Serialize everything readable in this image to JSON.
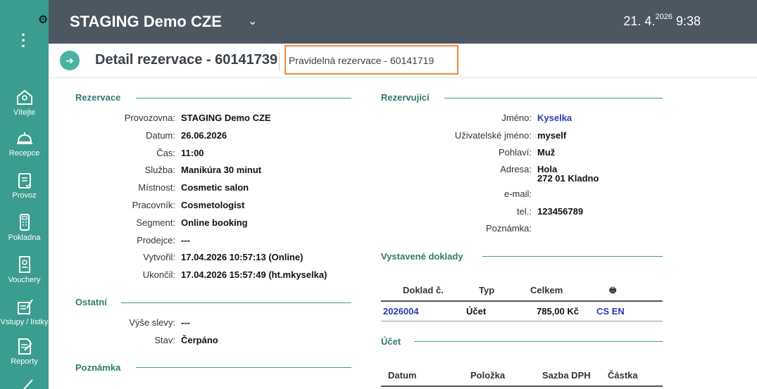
{
  "app": {
    "title": "STAGING Demo CZE",
    "date": "21. 4.",
    "year": "2026",
    "time": "9:38"
  },
  "sidebar": {
    "items": [
      {
        "label": "Vítejte",
        "icon": "home-icon"
      },
      {
        "label": "Recepce",
        "icon": "bell-icon"
      },
      {
        "label": "Provoz",
        "icon": "clipboard-icon"
      },
      {
        "label": "Pokladna",
        "icon": "cash-register-icon"
      },
      {
        "label": "Vouchery",
        "icon": "voucher-icon"
      },
      {
        "label": "Vstupy / lístky",
        "icon": "ticket-icon"
      },
      {
        "label": "Reporty",
        "icon": "report-icon"
      }
    ]
  },
  "detail": {
    "title": "Detail rezervace - 60141739",
    "regular": "Pravidelná rezervace - 60141719"
  },
  "reservation": {
    "section": "Rezervace",
    "rows": [
      {
        "key": "Provozovna:",
        "value": "STAGING Demo CZE"
      },
      {
        "key": "Datum:",
        "value": "26.06.2026"
      },
      {
        "key": "Čas:",
        "value": "11:00"
      },
      {
        "key": "Služba:",
        "value": "Manikúra 30 minut"
      },
      {
        "key": "Místnost:",
        "value": "Cosmetic salon"
      },
      {
        "key": "Pracovník:",
        "value": "Cosmetologist"
      },
      {
        "key": "Segment:",
        "value": "Online booking"
      },
      {
        "key": "Prodejce:",
        "value": "---"
      },
      {
        "key": "Vytvořil:",
        "value": "17.04.2026 10:57:13 (Online)"
      },
      {
        "key": "Ukončil:",
        "value": "17.04.2026 15:57:49 (ht.mkyselka)"
      }
    ]
  },
  "other": {
    "section": "Ostatní",
    "rows": [
      {
        "key": "Výše slevy:",
        "value": "---"
      },
      {
        "key": "Stav:",
        "value": "Čerpáno"
      }
    ]
  },
  "note": {
    "section": "Poznámka"
  },
  "booker": {
    "section": "Rezervující",
    "name_label": "Jméno:",
    "name": "Kyselka",
    "username_label": "Uživatelské jméno:",
    "username": "myself",
    "gender_label": "Pohlaví:",
    "gender": "Muž",
    "address_label": "Adresa:",
    "address_line1": "Hola",
    "address_line2": "272 01 Kladno",
    "email_label": "e-mail:",
    "phone_label": "tel.:",
    "phone": "123456789",
    "note_label": "Poznámka:"
  },
  "documents": {
    "section": "Vystavené doklady",
    "headers": {
      "doc": "Doklad č.",
      "type": "Typ",
      "total": "Celkem",
      "print": "🖶"
    },
    "rows": [
      {
        "doc": "2026004",
        "type": "Účet",
        "total": "785,00 Kč",
        "lang": "CS EN"
      }
    ]
  },
  "account": {
    "section": "Účet",
    "headers": {
      "date": "Datum",
      "item": "Položka",
      "vat": "Sazba DPH",
      "amount": "Částka"
    }
  },
  "colors": {
    "sidebar": "#3a9d8f",
    "topbar": "#4c5762",
    "accent": "#2e7a6f",
    "link": "#2a3bb0",
    "highlight": "#f08a36"
  }
}
